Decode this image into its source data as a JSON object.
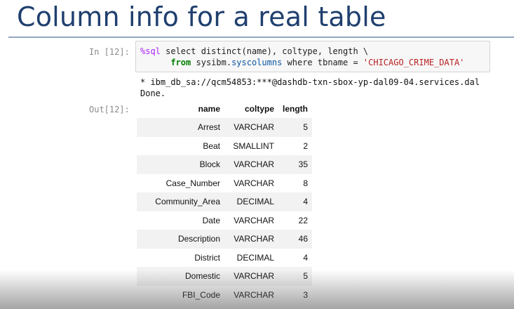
{
  "slide": {
    "title": "Column info for a real table"
  },
  "input_cell": {
    "prompt": "In [12]:",
    "line1_magic": "%sql",
    "line1_rest": " select distinct(name), coltype, length \\",
    "line2_indent": "      ",
    "line2_kw": "from",
    "line2_mid": " sysibm.",
    "line2_fn": "syscolumns",
    "line2_where": " where tbname = ",
    "line2_str": "'CHICAGO_CRIME_DATA'"
  },
  "output": {
    "connection": " * ibm_db_sa://qcm54853:***@dashdb-txn-sbox-yp-dal09-04.services.dal",
    "done": "Done.",
    "prompt": "Out[12]:"
  },
  "table": {
    "headers": {
      "name": "name",
      "coltype": "coltype",
      "length": "length"
    },
    "rows": [
      {
        "name": "Arrest",
        "coltype": "VARCHAR",
        "length": "5"
      },
      {
        "name": "Beat",
        "coltype": "SMALLINT",
        "length": "2"
      },
      {
        "name": "Block",
        "coltype": "VARCHAR",
        "length": "35"
      },
      {
        "name": "Case_Number",
        "coltype": "VARCHAR",
        "length": "8"
      },
      {
        "name": "Community_Area",
        "coltype": "DECIMAL",
        "length": "4"
      },
      {
        "name": "Date",
        "coltype": "VARCHAR",
        "length": "22"
      },
      {
        "name": "Description",
        "coltype": "VARCHAR",
        "length": "46"
      },
      {
        "name": "District",
        "coltype": "DECIMAL",
        "length": "4"
      },
      {
        "name": "Domestic",
        "coltype": "VARCHAR",
        "length": "5"
      },
      {
        "name": "FBI_Code",
        "coltype": "VARCHAR",
        "length": "3"
      }
    ]
  }
}
